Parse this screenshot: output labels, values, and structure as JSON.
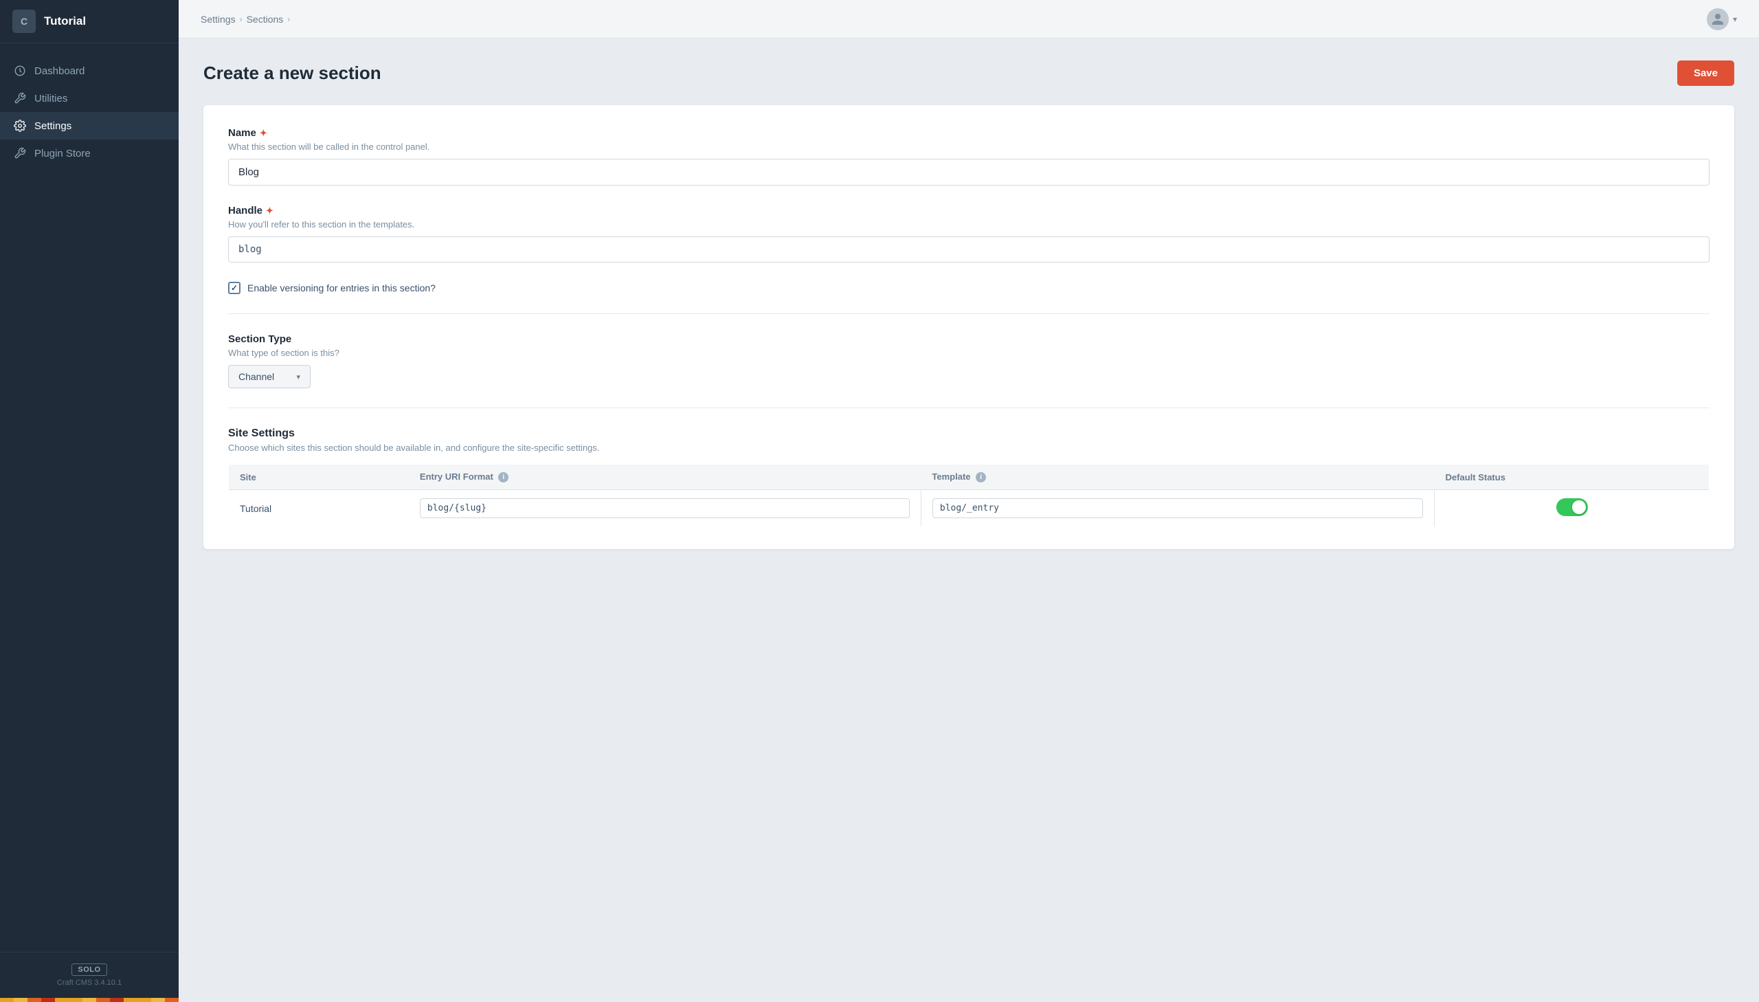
{
  "sidebar": {
    "logo_letter": "C",
    "title": "Tutorial",
    "items": [
      {
        "id": "dashboard",
        "label": "Dashboard",
        "icon": "dashboard-icon",
        "active": false
      },
      {
        "id": "utilities",
        "label": "Utilities",
        "icon": "utilities-icon",
        "active": false
      },
      {
        "id": "settings",
        "label": "Settings",
        "icon": "settings-icon",
        "active": true
      },
      {
        "id": "plugin-store",
        "label": "Plugin Store",
        "icon": "plugin-store-icon",
        "active": false
      }
    ],
    "footer": {
      "badge_label": "SOLO",
      "version": "Craft CMS 3.4.10.1"
    }
  },
  "topbar": {
    "breadcrumb": [
      {
        "label": "Settings",
        "href": "#"
      },
      {
        "label": "Sections",
        "href": "#"
      }
    ],
    "user_icon": "user-icon"
  },
  "page": {
    "title": "Create a new section",
    "save_label": "Save"
  },
  "form": {
    "name_label": "Name",
    "name_required": true,
    "name_hint": "What this section will be called in the control panel.",
    "name_value": "Blog",
    "handle_label": "Handle",
    "handle_required": true,
    "handle_hint": "How you'll refer to this section in the templates.",
    "handle_value": "blog",
    "versioning_label": "Enable versioning for entries in this section?",
    "versioning_checked": true,
    "section_type_label": "Section Type",
    "section_type_hint": "What type of section is this?",
    "section_type_value": "Channel",
    "site_settings_title": "Site Settings",
    "site_settings_hint": "Choose which sites this section should be available in, and configure the site-specific settings.",
    "table": {
      "headers": [
        "Site",
        "Entry URI Format",
        "Template",
        "Default Status"
      ],
      "rows": [
        {
          "site": "Tutorial",
          "entry_uri": "blog/{slug}",
          "template": "blog/_entry",
          "default_status": true
        }
      ]
    }
  }
}
